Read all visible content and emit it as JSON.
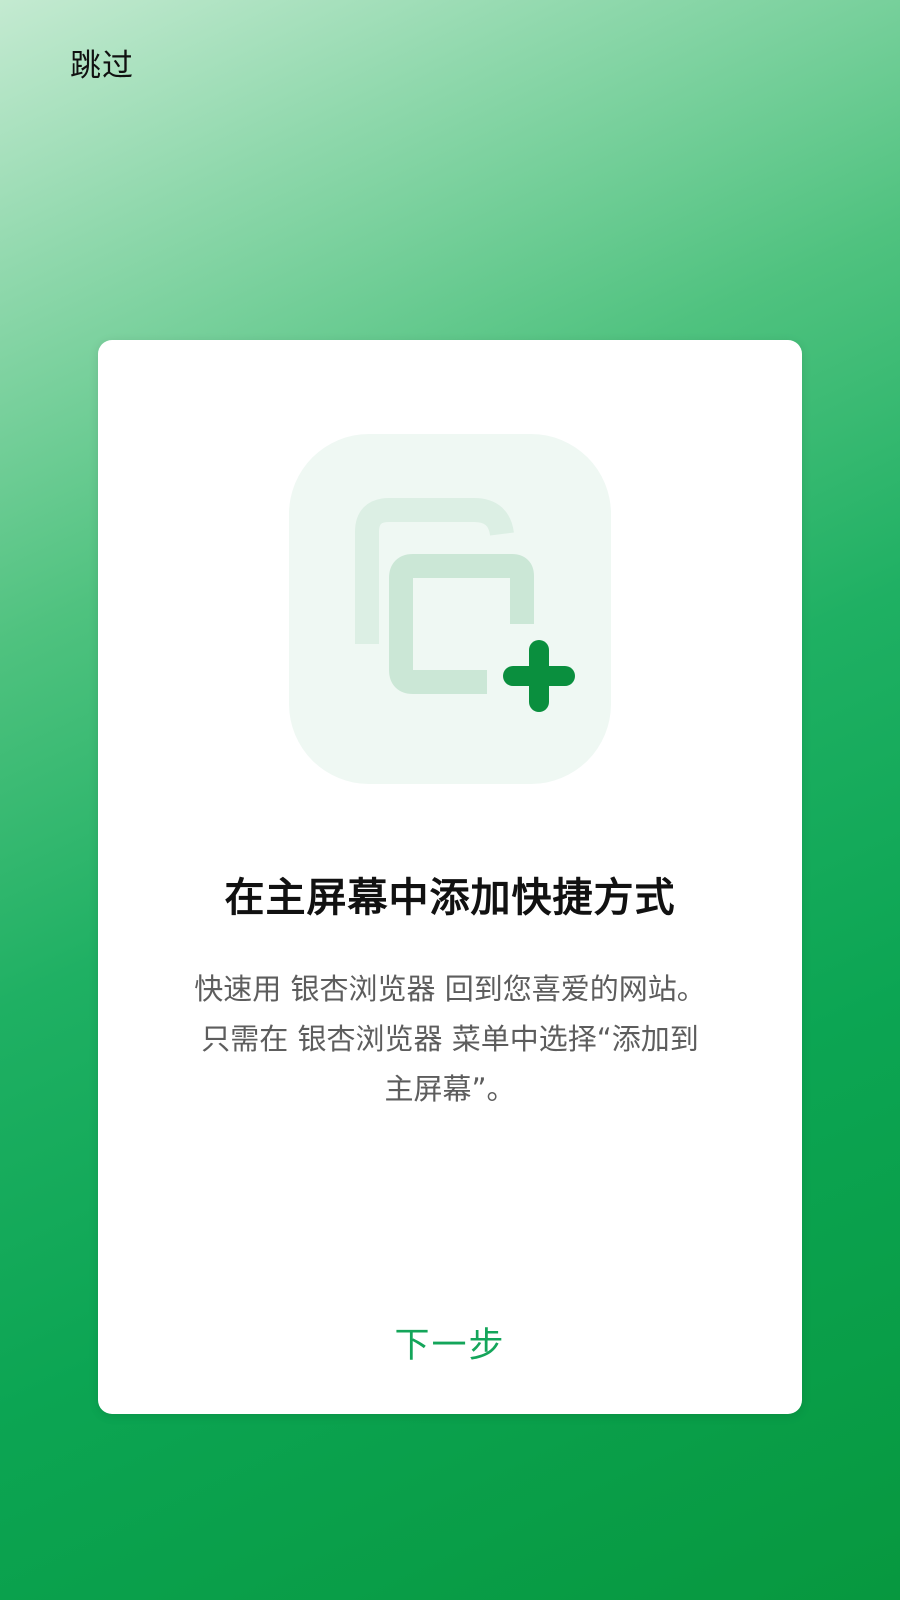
{
  "header": {
    "skip_label": "跳过"
  },
  "card": {
    "illustration_icon": "add-shortcut-icon",
    "title": "在主屏幕中添加快捷方式",
    "description_lines": [
      "快速用 银杏浏览器 回到您喜爱的网站。",
      "只需在 银杏浏览器 菜单中选择“添加到",
      "主屏幕”。"
    ],
    "next_label": "下一步"
  },
  "colors": {
    "accent": "#14a55a",
    "plus_icon": "#0a8f3e",
    "background_top": "#c4ead1",
    "background_bottom": "#07983f"
  }
}
